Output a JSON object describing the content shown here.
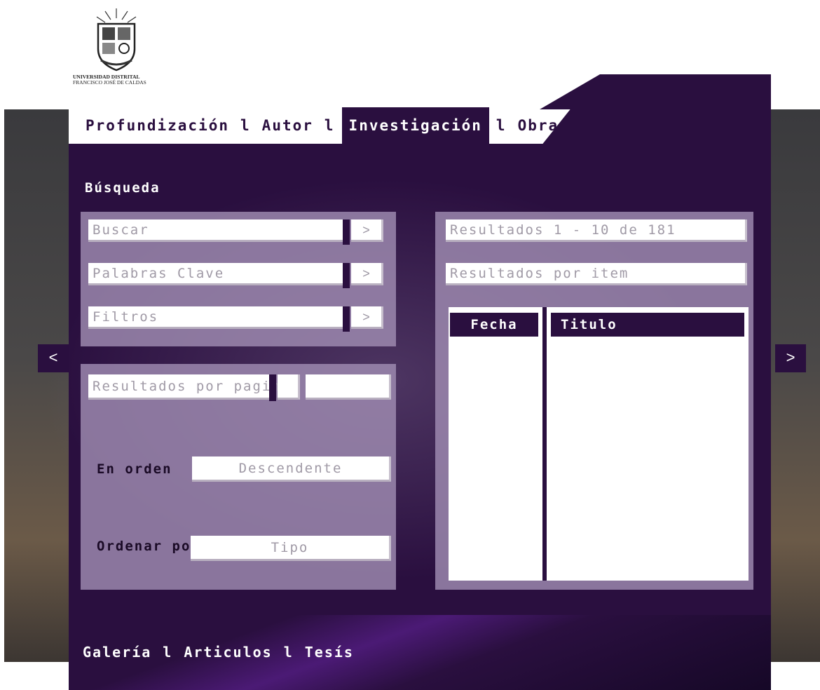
{
  "logo": {
    "university_line1": "UNIVERSIDAD DISTRITAL",
    "university_line2": "FRANCISCO JOSÉ DE CALDAS"
  },
  "tabs": [
    {
      "label": "Profundización",
      "active": false
    },
    {
      "label": "Autor",
      "active": false
    },
    {
      "label": "Investigación",
      "active": true
    },
    {
      "label": "Obra",
      "active": false
    }
  ],
  "tab_separator": "l",
  "search": {
    "title": "Búsqueda",
    "fields": [
      {
        "label": "Buscar",
        "button": ">"
      },
      {
        "label": "Palabras Clave",
        "button": ">"
      },
      {
        "label": "Filtros",
        "button": ">"
      }
    ]
  },
  "options": {
    "results_per_page_label": "Resultados por pagina",
    "results_per_page_value": "",
    "order_label": "En orden",
    "order_value": "Descendente",
    "sort_label": "Ordenar por",
    "sort_value": "Tipo"
  },
  "results": {
    "summary": "Resultados 1 - 10 de 181",
    "per_item": "Resultados por item",
    "columns": [
      "Fecha",
      "Titulo"
    ]
  },
  "nav": {
    "prev": "<",
    "next": ">"
  },
  "footer": {
    "links": [
      "Galería",
      "Articulos",
      "Tesís"
    ],
    "separator": "l"
  },
  "colors": {
    "brand_purple": "#2a0f3f",
    "panel_lilac": "#a08cb2"
  }
}
